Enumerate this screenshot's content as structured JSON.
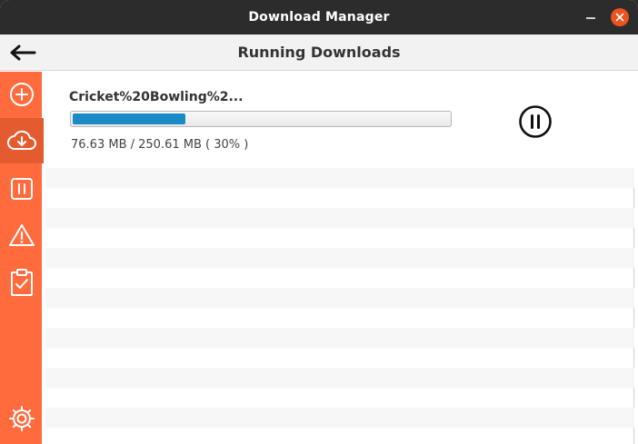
{
  "window": {
    "title": "Download Manager"
  },
  "header": {
    "title": "Running Downloads"
  },
  "sidebar": {
    "items": [
      {
        "icon": "add-icon"
      },
      {
        "icon": "download-cloud-icon",
        "active": true
      },
      {
        "icon": "paused-icon"
      },
      {
        "icon": "warning-icon"
      },
      {
        "icon": "clipboard-check-icon"
      },
      {
        "icon": "gear-icon"
      }
    ]
  },
  "downloads": [
    {
      "name": "Cricket%20Bowling%2...",
      "size_text": "76.63 MB / 250.61 MB ( 30% )",
      "progress": 0.3
    }
  ],
  "colors": {
    "accent": "#ff6b3d",
    "progress": "#1a8bc4",
    "titlebar": "#2c2c2c",
    "close": "#e95420"
  }
}
